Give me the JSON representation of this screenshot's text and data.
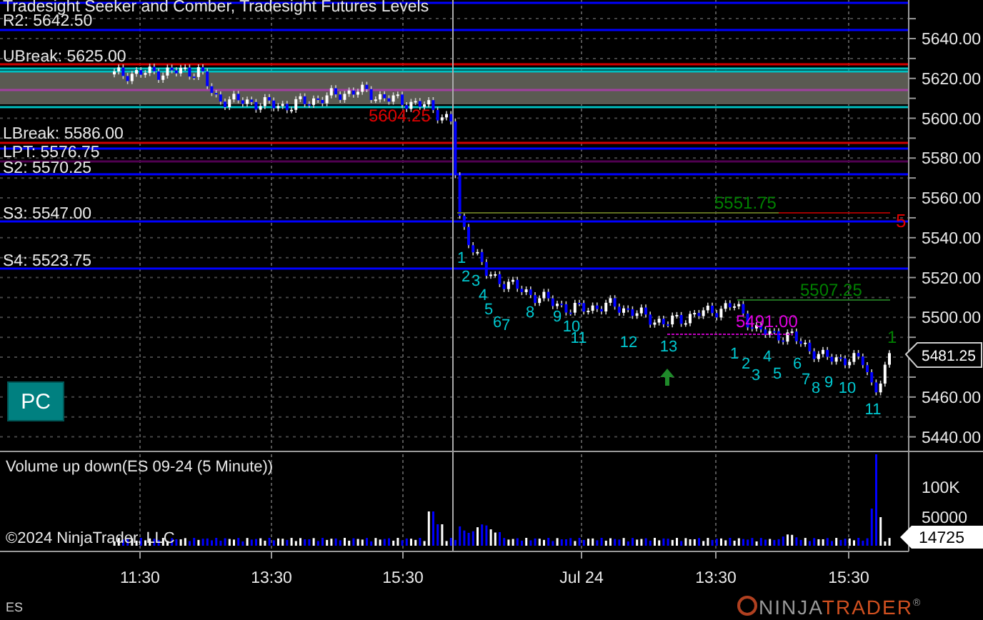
{
  "chart_title": "Tradesight Seeker and Comber, Tradesight Futures Levels",
  "levels": [
    {
      "label": "R2: 5642.50",
      "color": "#0000ff"
    },
    {
      "label": "UBreak: 5625.00",
      "color": "#d00000"
    },
    {
      "label": "LBreak: 5586.00",
      "color": "#d00000"
    },
    {
      "label": "LPT: 5576.75",
      "color": "#0000ff"
    },
    {
      "label": "S2: 5570.25",
      "color": "#0000ff"
    },
    {
      "label": "S3: 5547.00",
      "color": "#0000ff"
    },
    {
      "label": "S4: 5523.75",
      "color": "#0000ff"
    }
  ],
  "annotations": [
    {
      "label": "5604.25",
      "color": "#e00000"
    },
    {
      "label": "5551.75",
      "color": "#008000"
    },
    {
      "label": "5",
      "color": "#e00000"
    },
    {
      "label": "5507.25",
      "color": "#008000"
    },
    {
      "label": "5491.00",
      "color": "#e000e0"
    },
    {
      "label": "1",
      "color": "#008000"
    }
  ],
  "count_labels": [
    "1",
    "2",
    "3",
    "4",
    "5",
    "6",
    "7",
    "8",
    "9",
    "10",
    "11",
    "12",
    "13",
    "1",
    "2",
    "3",
    "4",
    "5",
    "6",
    "7",
    "8",
    "9",
    "10",
    "11"
  ],
  "price_axis": {
    "ticks": [
      "5640.00",
      "5620.00",
      "5600.00",
      "5580.00",
      "5560.00",
      "5540.00",
      "5520.00",
      "5500.00",
      "5460.00",
      "5440.00"
    ],
    "current": "5481.25"
  },
  "pc_button": "PC",
  "volume_panel": {
    "title": "Volume up down(ES 09-24 (5 Minute))",
    "ticks": [
      "100K",
      "50000"
    ],
    "current": "14725",
    "copyright": "©2024 NinjaTrader, LLC"
  },
  "time_axis": [
    "11:30",
    "13:30",
    "15:30",
    "Jul 24",
    "13:30",
    "15:30"
  ],
  "instrument": "ES",
  "logo": {
    "part_1": "NINJA",
    "part_2": "TRADER",
    "mark": "®"
  }
}
